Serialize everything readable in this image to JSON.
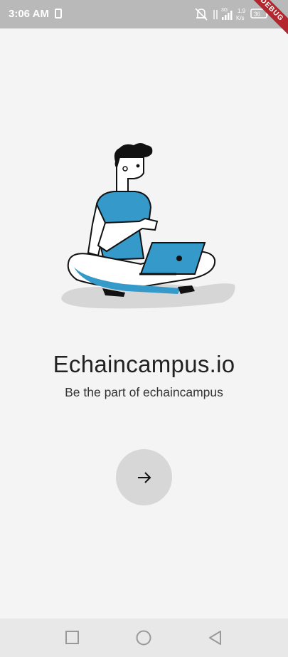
{
  "status_bar": {
    "time": "3:06 AM",
    "network_type": "3G",
    "speed_value": "1.9",
    "speed_unit": "K/s",
    "battery": "36",
    "icons": [
      "notification-icon",
      "mute-icon",
      "data-arrows-icon",
      "signal-icon",
      "battery-icon"
    ]
  },
  "debug_banner": "DEBUG",
  "onboarding": {
    "title": "Echaincampus.io",
    "subtitle": "Be the part of echaincampus",
    "next_button_icon": "arrow-right-icon"
  },
  "colors": {
    "accent": "#3599c9",
    "background": "#f3f4f3",
    "status_bar": "#b9b9b9",
    "button": "#d7d7d7",
    "debug": "#b3262d"
  },
  "nav_bar": {
    "icons": [
      "recent-apps-icon",
      "home-icon",
      "back-icon"
    ]
  }
}
